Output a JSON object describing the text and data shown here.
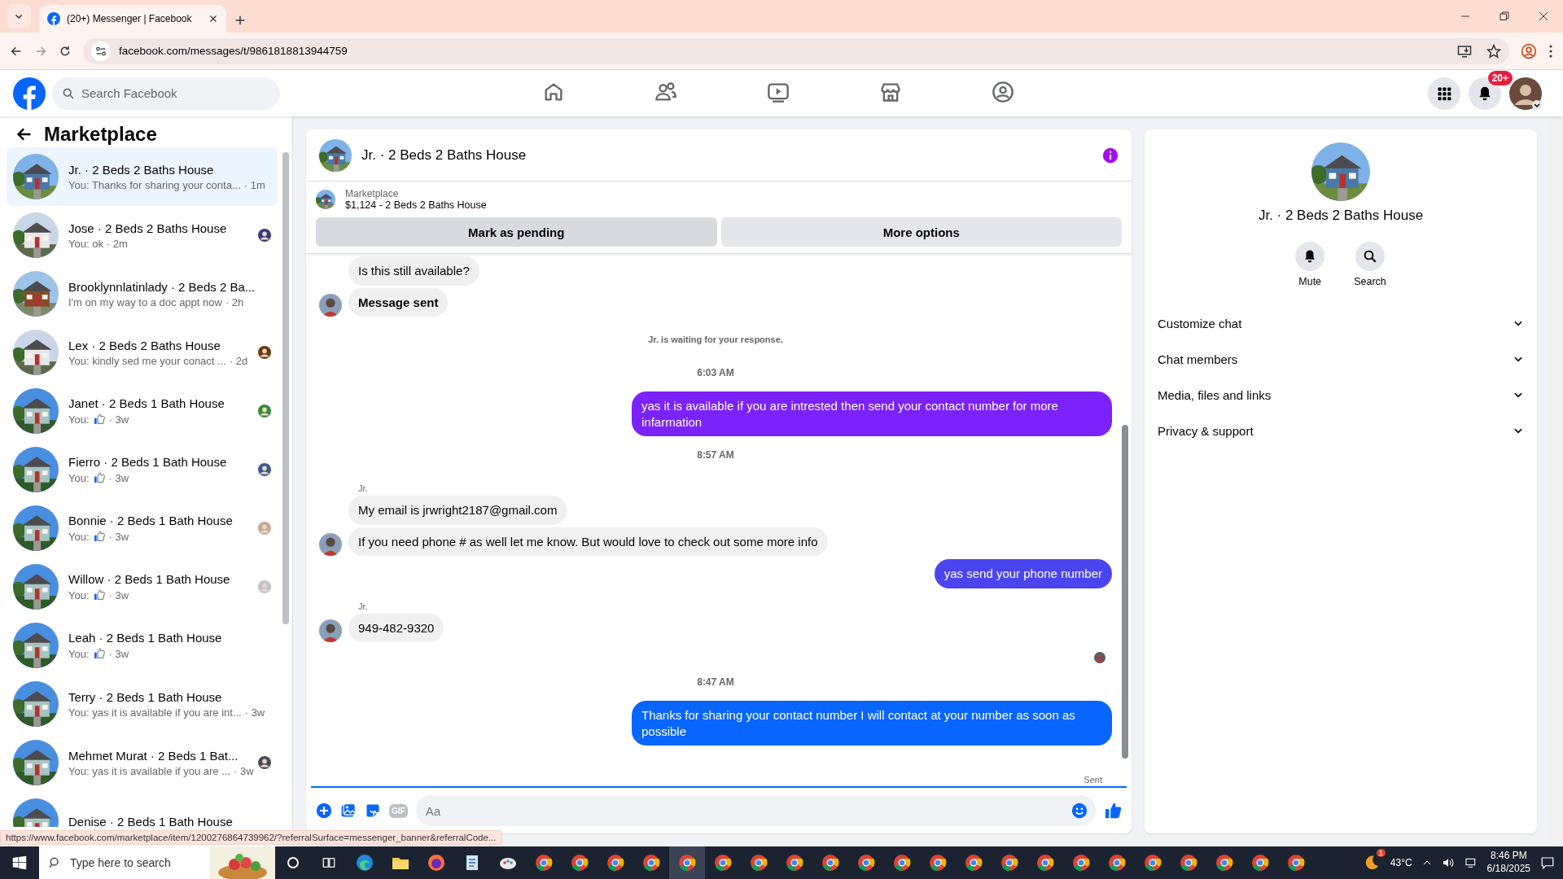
{
  "browser": {
    "tab_title": "(20+) Messenger | Facebook",
    "url": "facebook.com/messages/t/9861818813944759",
    "status_url": "https://www.facebook.com/marketplace/item/1200276864739962/?referralSurface=messenger_banner&referralCode..."
  },
  "header": {
    "search_placeholder": "Search Facebook",
    "nav": [
      {
        "kind": "home"
      },
      {
        "kind": "friends"
      },
      {
        "kind": "video"
      },
      {
        "kind": "marketplace"
      },
      {
        "kind": "groups"
      }
    ],
    "notification_badge": "20+"
  },
  "sidebar": {
    "title": "Marketplace",
    "conversations": [
      {
        "name": "Jr. · 2 Beds 2 Baths House",
        "preview": "You: Thanks for sharing your conta...",
        "like": false,
        "time": "· 1m",
        "selected": true,
        "seen": false
      },
      {
        "name": "Jose · 2 Beds 2 Baths House",
        "preview": "You: ok",
        "like": false,
        "time": "· 2m",
        "selected": false,
        "seen": true
      },
      {
        "name": "Brooklynnlatinlady · 2 Beds 2 Ba...",
        "preview": "I'm on my way to a doc appt now",
        "like": false,
        "time": "· 2h",
        "selected": false,
        "seen": false
      },
      {
        "name": "Lex · 2 Beds 2 Baths House",
        "preview": "You: kindly sed me your conact ...",
        "like": false,
        "time": "· 2d",
        "selected": false,
        "seen": true
      },
      {
        "name": "Janet · 2 Beds 1 Bath House",
        "preview": "You:",
        "like": true,
        "time": "· 3w",
        "selected": false,
        "seen": true
      },
      {
        "name": "Fierro · 2 Beds 1 Bath House",
        "preview": "You:",
        "like": true,
        "time": "· 3w",
        "selected": false,
        "seen": true
      },
      {
        "name": "Bonnie · 2 Beds 1 Bath House",
        "preview": "You:",
        "like": true,
        "time": "· 3w",
        "selected": false,
        "seen": true
      },
      {
        "name": "Willow · 2 Beds 1 Bath House",
        "preview": "You:",
        "like": true,
        "time": "· 3w",
        "selected": false,
        "seen": true
      },
      {
        "name": "Leah · 2 Beds 1 Bath House",
        "preview": "You:",
        "like": true,
        "time": "· 3w",
        "selected": false,
        "seen": false
      },
      {
        "name": "Terry · 2 Beds 1 Bath House",
        "preview": "You: yas it is available if you are int...",
        "like": false,
        "time": "· 3w",
        "selected": false,
        "seen": false
      },
      {
        "name": "Mehmet Murat · 2 Beds 1 Bat...",
        "preview": "You: yas it is available if you are ...",
        "like": false,
        "time": "· 3w",
        "selected": false,
        "seen": true
      },
      {
        "name": "Denise · 2 Beds 1 Bath House",
        "selected": false,
        "seen": false
      }
    ]
  },
  "chat": {
    "title": "Jr. · 2 Beds 2 Baths House",
    "listing": {
      "label": "Marketplace",
      "title": "$1,124 - 2 Beds 2 Baths House"
    },
    "actions": [
      "Mark as pending",
      "More options"
    ],
    "messages": [
      {
        "kind": "incoming",
        "text": "Is this still available?",
        "avatar": false,
        "bold": false
      },
      {
        "kind": "incoming",
        "text": "Message sent",
        "avatar": true,
        "bold": true
      },
      {
        "kind": "system",
        "text": "Jr. is waiting for your response."
      },
      {
        "kind": "time",
        "text": "6:03 AM"
      },
      {
        "kind": "outgoing",
        "text": "yas it is available if you are intrested then send your contact number for more infarmation",
        "color": "#7b22fb"
      },
      {
        "kind": "time",
        "text": "8:57 AM"
      },
      {
        "kind": "sender",
        "text": "Jr."
      },
      {
        "kind": "incoming",
        "text": "My email is jrwright2187@gmail.com",
        "avatar": false,
        "bold": false
      },
      {
        "kind": "incoming",
        "text": "If you need phone # as well let me know. But would love to check out some more info",
        "avatar": true,
        "bold": false
      },
      {
        "kind": "outgoing",
        "text": "yas send your phone number",
        "color": "#4b45f0"
      },
      {
        "kind": "sender",
        "text": "Jr."
      },
      {
        "kind": "incoming",
        "text": "949-482-9320",
        "avatar": true,
        "bold": false
      },
      {
        "kind": "seen"
      },
      {
        "kind": "time",
        "text": "8:47 AM"
      },
      {
        "kind": "outgoing",
        "text": "Thanks for sharing your contact number I will contact at your number as soon as possible",
        "color": "#0866ff"
      }
    ],
    "delivery_status": "Sent",
    "composer": {
      "gif_label": "GIF",
      "placeholder": "Aa"
    }
  },
  "info": {
    "title": "Jr. · 2 Beds 2 Baths House",
    "buttons": [
      {
        "kind": "mute",
        "label": "Mute"
      },
      {
        "kind": "search",
        "label": "Search"
      }
    ],
    "sections": [
      {
        "label": "Customize chat",
        "expanded": false
      },
      {
        "label": "Chat members",
        "expanded": false
      },
      {
        "label": "Media, files and links",
        "expanded": false
      },
      {
        "label": "Privacy & support",
        "expanded": false
      }
    ]
  },
  "taskbar": {
    "search_placeholder": "Type here to search",
    "apps": [
      {
        "kind": "edge",
        "selected": false
      },
      {
        "kind": "folder",
        "selected": false
      },
      {
        "kind": "firefox",
        "selected": false
      },
      {
        "kind": "notepad",
        "selected": false
      },
      {
        "kind": "paint",
        "selected": false
      },
      {
        "kind": "chrome",
        "selected": false
      },
      {
        "kind": "chrome",
        "selected": false
      },
      {
        "kind": "chrome",
        "selected": false
      },
      {
        "kind": "chrome",
        "selected": false
      },
      {
        "kind": "chrome",
        "selected": true
      },
      {
        "kind": "chrome",
        "selected": false
      },
      {
        "kind": "chrome",
        "selected": false
      },
      {
        "kind": "chrome",
        "selected": false
      },
      {
        "kind": "chrome",
        "selected": false
      },
      {
        "kind": "chrome",
        "selected": false
      },
      {
        "kind": "chrome",
        "selected": false
      },
      {
        "kind": "chrome",
        "selected": false
      },
      {
        "kind": "chrome",
        "selected": false
      },
      {
        "kind": "chrome",
        "selected": false
      },
      {
        "kind": "chrome",
        "selected": false
      },
      {
        "kind": "chrome",
        "selected": false
      },
      {
        "kind": "chrome",
        "selected": false
      },
      {
        "kind": "chrome",
        "selected": false
      },
      {
        "kind": "chrome",
        "selected": false
      },
      {
        "kind": "chrome",
        "selected": false
      },
      {
        "kind": "chrome",
        "selected": false
      },
      {
        "kind": "chrome",
        "selected": false
      }
    ],
    "weather_badge": "1",
    "temperature": "43°C",
    "time": "8:46 PM",
    "date": "6/18/2025"
  }
}
